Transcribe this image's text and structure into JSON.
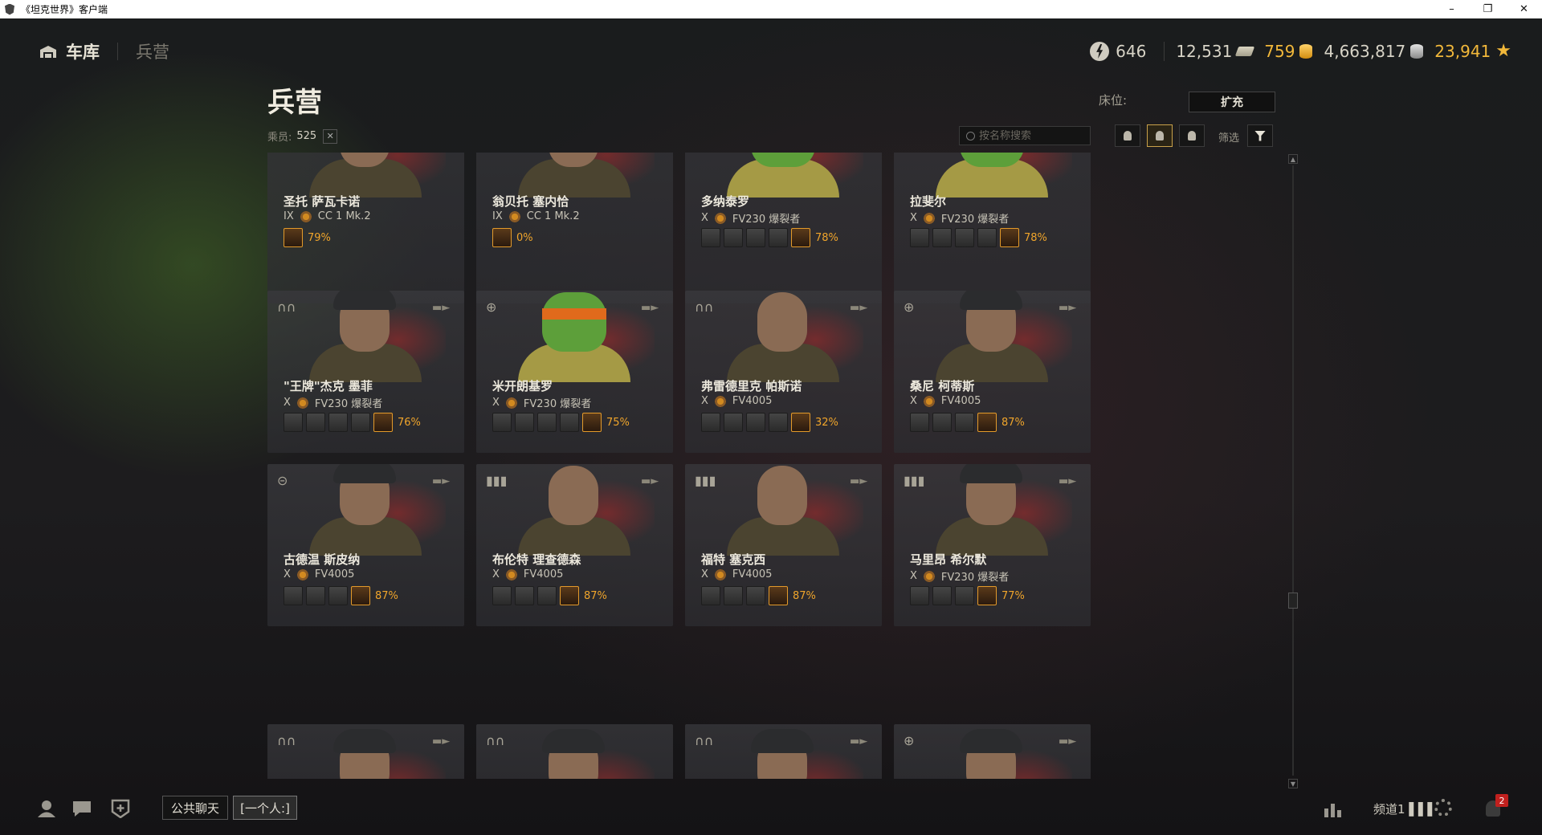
{
  "window": {
    "title": "《坦克世界》客户端"
  },
  "nav": {
    "garage": "车库",
    "barracks": "兵营"
  },
  "currency": {
    "free_xp": "646",
    "bonds": "12,531",
    "gold": "759",
    "credits": "4,663,817",
    "xp": "23,941"
  },
  "page": {
    "title": "兵营",
    "crew_label": "乘员:",
    "crew_count": "525",
    "berths_label": "床位:",
    "expand_label": "扩充",
    "search_placeholder": "按名称搜索",
    "filter_label": "筛选"
  },
  "crew": [
    {
      "name": "圣托 萨瓦卡诺",
      "tier": "IX",
      "vehicle": "CC 1 Mk.2",
      "role": "commander",
      "skill_count": 1,
      "progress": "79%",
      "portrait": "human-cap"
    },
    {
      "name": "翁贝托 塞内恰",
      "tier": "IX",
      "vehicle": "CC 1 Mk.2",
      "role": "commander",
      "skill_count": 1,
      "progress": "0%",
      "portrait": "human-cap"
    },
    {
      "name": "多纳泰罗",
      "tier": "X",
      "vehicle": "FV230 爆裂者",
      "role": "commander",
      "skill_count": 5,
      "progress": "78%",
      "portrait": "turtle"
    },
    {
      "name": "拉斐尔",
      "tier": "X",
      "vehicle": "FV230 爆裂者",
      "role": "commander",
      "skill_count": 5,
      "progress": "78%",
      "portrait": "turtle"
    },
    {
      "name": "\"王牌\"杰克 墨菲",
      "tier": "X",
      "vehicle": "FV230 爆裂者",
      "role": "binoculars",
      "skill_count": 5,
      "progress": "76%",
      "portrait": "human-goggles"
    },
    {
      "name": "米开朗基罗",
      "tier": "X",
      "vehicle": "FV230 爆裂者",
      "role": "crosshair",
      "skill_count": 5,
      "progress": "75%",
      "portrait": "turtle"
    },
    {
      "name": "弗雷德里克 帕斯诺",
      "tier": "X",
      "vehicle": "FV4005",
      "role": "binoculars",
      "skill_count": 5,
      "progress": "32%",
      "portrait": "human"
    },
    {
      "name": "桑尼 柯蒂斯",
      "tier": "X",
      "vehicle": "FV4005",
      "role": "crosshair",
      "skill_count": 4,
      "progress": "87%",
      "portrait": "human-beret"
    },
    {
      "name": "古德温 斯皮纳",
      "tier": "X",
      "vehicle": "FV4005",
      "role": "wheel",
      "skill_count": 4,
      "progress": "87%",
      "portrait": "human-beret"
    },
    {
      "name": "布伦特 理查德森",
      "tier": "X",
      "vehicle": "FV4005",
      "role": "shells",
      "skill_count": 4,
      "progress": "87%",
      "portrait": "human"
    },
    {
      "name": "福特 塞克西",
      "tier": "X",
      "vehicle": "FV4005",
      "role": "shells",
      "skill_count": 4,
      "progress": "87%",
      "portrait": "human"
    },
    {
      "name": "马里昂 希尔默",
      "tier": "X",
      "vehicle": "FV230 爆裂者",
      "role": "shells",
      "skill_count": 4,
      "progress": "77%",
      "portrait": "human-helmet"
    }
  ],
  "bottom": {
    "public_chat": "公共聊天",
    "personal": "[一个人:]",
    "channel": "频道1",
    "notifications": "2"
  },
  "colors": {
    "accent": "#f0a52b",
    "background": "#1b1b1d",
    "badge": "#c0201e"
  },
  "icons": {
    "roles": {
      "commander": "commander-icon",
      "binoculars": "binoculars-icon",
      "crosshair": "crosshair-icon",
      "wheel": "steering-wheel-icon",
      "shells": "shells-icon"
    }
  }
}
